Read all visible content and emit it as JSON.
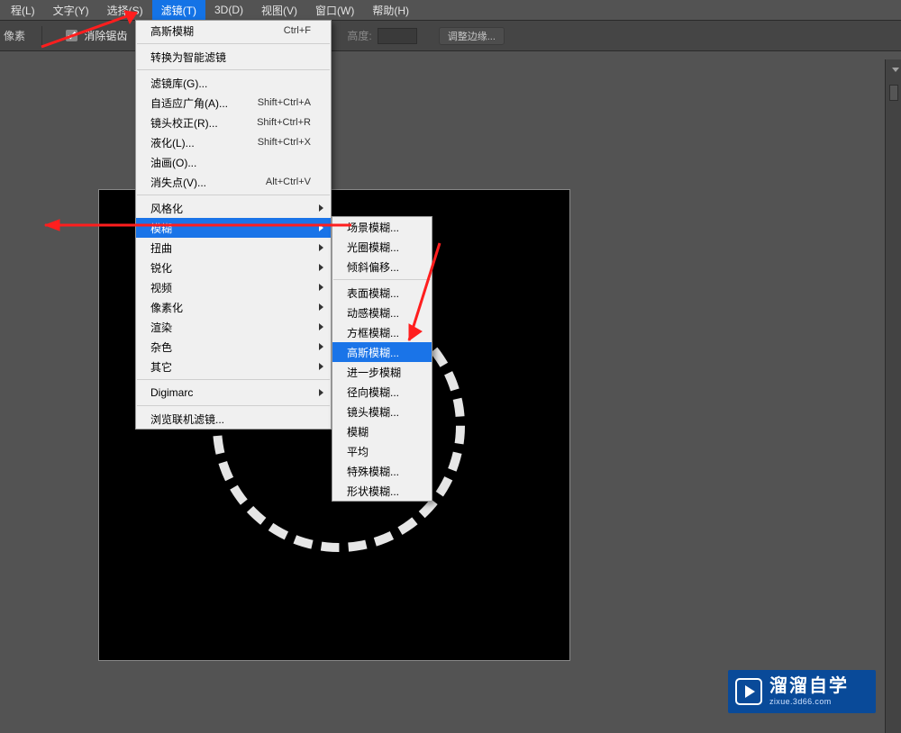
{
  "menubar": {
    "items": [
      {
        "label": "程(L)"
      },
      {
        "label": "文字(Y)"
      },
      {
        "label": "选择(S)"
      },
      {
        "label": "滤镜(T)"
      },
      {
        "label": "3D(D)"
      },
      {
        "label": "视图(V)"
      },
      {
        "label": "窗口(W)"
      },
      {
        "label": "帮助(H)"
      }
    ],
    "open_index": 3
  },
  "toolbar": {
    "px_label": "像素",
    "antialias_label": "消除锯齿",
    "antialias_checked": true,
    "height_label": "高度:",
    "adjust_edge_label": "调整边缘..."
  },
  "main_menu": {
    "items": [
      {
        "label": "高斯模糊",
        "shortcut": "Ctrl+F"
      },
      {
        "divider": true
      },
      {
        "label": "转换为智能滤镜"
      },
      {
        "divider": true
      },
      {
        "label": "滤镜库(G)..."
      },
      {
        "label": "自适应广角(A)...",
        "shortcut": "Shift+Ctrl+A"
      },
      {
        "label": "镜头校正(R)...",
        "shortcut": "Shift+Ctrl+R"
      },
      {
        "label": "液化(L)...",
        "shortcut": "Shift+Ctrl+X"
      },
      {
        "label": "油画(O)..."
      },
      {
        "label": "消失点(V)...",
        "shortcut": "Alt+Ctrl+V"
      },
      {
        "divider": true
      },
      {
        "label": "风格化",
        "submenu": true
      },
      {
        "label": "模糊",
        "submenu": true,
        "highlight": true
      },
      {
        "label": "扭曲",
        "submenu": true
      },
      {
        "label": "锐化",
        "submenu": true
      },
      {
        "label": "视频",
        "submenu": true
      },
      {
        "label": "像素化",
        "submenu": true
      },
      {
        "label": "渲染",
        "submenu": true
      },
      {
        "label": "杂色",
        "submenu": true
      },
      {
        "label": "其它",
        "submenu": true
      },
      {
        "divider": true
      },
      {
        "label": "Digimarc",
        "submenu": true
      },
      {
        "divider": true
      },
      {
        "label": "浏览联机滤镜..."
      }
    ]
  },
  "sub_menu": {
    "items": [
      {
        "label": "场景模糊..."
      },
      {
        "label": "光圈模糊..."
      },
      {
        "label": "倾斜偏移..."
      },
      {
        "divider": true
      },
      {
        "label": "表面模糊..."
      },
      {
        "label": "动感模糊..."
      },
      {
        "label": "方框模糊..."
      },
      {
        "label": "高斯模糊...",
        "highlight": true
      },
      {
        "label": "进一步模糊"
      },
      {
        "label": "径向模糊..."
      },
      {
        "label": "镜头模糊..."
      },
      {
        "label": "模糊"
      },
      {
        "label": "平均"
      },
      {
        "label": "特殊模糊..."
      },
      {
        "label": "形状模糊..."
      }
    ]
  },
  "watermark": {
    "cn": "溜溜自学",
    "en": "zixue.3d66.com"
  }
}
